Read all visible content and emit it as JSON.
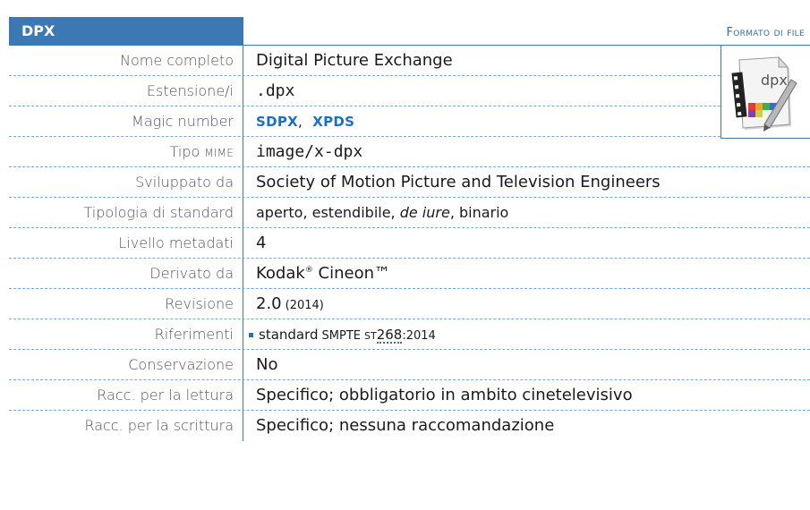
{
  "header": {
    "title": "DPX",
    "category": "Formato di file"
  },
  "icon": {
    "name": "dpx-file-icon",
    "text": "dpx"
  },
  "rows": [
    {
      "label": "Nome completo",
      "value": "Digital Picture Exchange"
    },
    {
      "label": "Estensione/i",
      "value": ".dpx"
    },
    {
      "label": "Magic number",
      "values": [
        "SDPX",
        "XPDS"
      ],
      "separator": ","
    },
    {
      "label_main": "Tipo",
      "label_sc": "MIME",
      "value": "image/x-dpx"
    },
    {
      "label": "Sviluppato da",
      "value": "Society of Motion Picture and Television Engineers"
    },
    {
      "label": "Tipologia di standard",
      "value_a": "aperto, estendibile, ",
      "value_italic": "de iure",
      "value_b": ", binario"
    },
    {
      "label": "Livello metadati",
      "value": "4"
    },
    {
      "label": "Derivato da",
      "value_a": "Kodak",
      "value_reg": "®",
      "value_b": " Cineon™"
    },
    {
      "label": "Revisione",
      "value": "2.0",
      "value_year": "(2014)"
    },
    {
      "label": "Riferimenti",
      "ref_text": "standard",
      "ref_org": "SMPTE",
      "ref_st": "ST",
      "ref_num": "268",
      "ref_year": ":2014"
    },
    {
      "label": "Conservazione",
      "value": "No"
    },
    {
      "label": "Racc. per la lettura",
      "value": "Specifico; obbligatorio in ambito cinetelevisivo"
    },
    {
      "label": "Racc. per la scrittura",
      "value": "Specifico; nessuna raccomandazione"
    }
  ],
  "colors": {
    "accent": "#3b78b4",
    "link": "#1c6fc9",
    "label_text": "#555555"
  }
}
